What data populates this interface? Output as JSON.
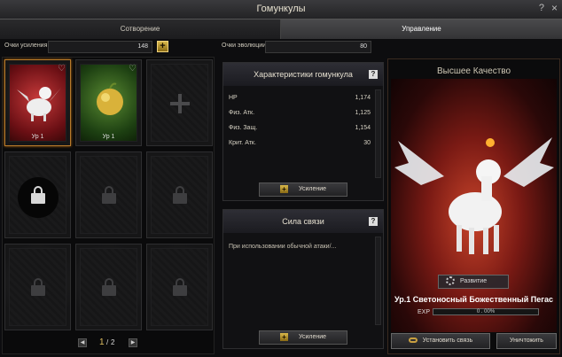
{
  "window": {
    "title": "Гомункулы",
    "help": "?",
    "close": "×"
  },
  "tabs": [
    {
      "label": "Сотворение",
      "active": false
    },
    {
      "label": "Управление",
      "active": true
    }
  ],
  "points": {
    "enhance_label": "Очки усиления",
    "enhance_value": "148",
    "evolution_label": "Очки эволюции",
    "evolution_value": "80"
  },
  "slots": [
    {
      "level": "Ур 1",
      "state": "pet",
      "color": "#c63a3a"
    },
    {
      "level": "Ур 1",
      "state": "pet",
      "color": "#5a8a32"
    },
    {
      "state": "empty"
    },
    {
      "state": "locked-current"
    },
    {
      "state": "locked"
    },
    {
      "state": "locked"
    },
    {
      "state": "locked"
    },
    {
      "state": "locked"
    },
    {
      "state": "locked"
    }
  ],
  "pager": {
    "current": "1",
    "separator": "/",
    "total": "2"
  },
  "stats_panel": {
    "title": "Характеристики гомункула",
    "rows": [
      {
        "key": "HP",
        "value": "1,174"
      },
      {
        "key": "Физ. Атк.",
        "value": "1,125"
      },
      {
        "key": "Физ. Защ.",
        "value": "1,154"
      },
      {
        "key": "Крит. Атк.",
        "value": "30"
      }
    ],
    "button": "Усиление"
  },
  "bond_panel": {
    "title": "Сила связи",
    "text": "При использовании обычной атаки/...",
    "button": "Усиление"
  },
  "pet_panel": {
    "quality": "Высшее Качество",
    "develop_button": "Развитие",
    "name": "Ур.1 Светоносный Божественный Пегас",
    "exp_label": "EXP",
    "exp_value": "0 . 00%",
    "exp_progress": 0,
    "bind_button": "Установить связь",
    "destroy_button": "Уничтожить"
  }
}
